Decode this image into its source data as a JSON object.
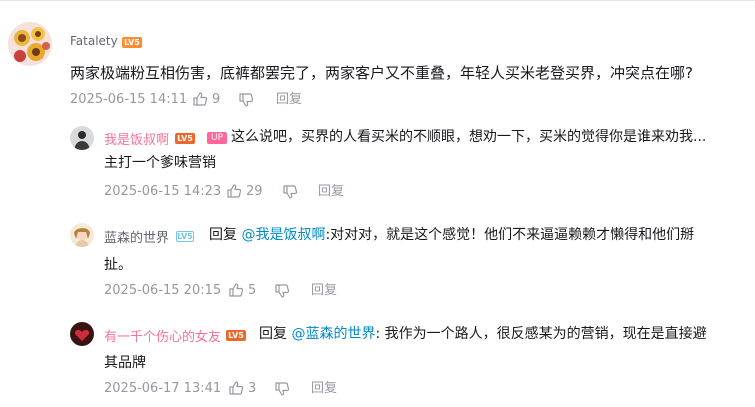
{
  "comments": [
    {
      "username": "Fatalety",
      "level": "LV5",
      "content": "两家极端粉互相伤害，底裤都罢完了，两家客户又不重叠，年轻人买米老登买界，冲突点在哪?",
      "time": "2025-06-15 14:11",
      "likes": "9",
      "reply_label": "回复"
    }
  ],
  "replies": [
    {
      "username": "我是饭叔啊",
      "level": "LV5",
      "badge": "UP",
      "line1": "这么说吧，买界的人看买米的不顺眼，想劝一下，买米的觉得你是谁来劝我...",
      "line2": "主打一个爹味营销",
      "time": "2025-06-15 14:23",
      "likes": "29",
      "reply_label": "回复"
    },
    {
      "username": "蓝森的世界",
      "level": "LV5",
      "reply_prefix": "回复",
      "mention": "@我是饭叔啊",
      "line1": ":对对对，就是这个感觉！他们不来逼逼赖赖才懒得和他们掰",
      "line2": "扯。",
      "time": "2025-06-15 20:15",
      "likes": "5",
      "reply_label": "回复"
    },
    {
      "username": "有一千个伤心的女友",
      "level": "LV5",
      "reply_prefix": "回复",
      "mention": "@蓝森的世界",
      "line1": ": 我作为一个路人，很反感某为的营销，现在是直接避",
      "line2": "其品牌",
      "time": "2025-06-17 13:41",
      "likes": "3",
      "reply_label": "回复"
    }
  ],
  "icons": {
    "like": "thumbs-up-icon",
    "dislike": "thumbs-down-icon"
  },
  "colors": {
    "vip_pink": "#fb7299",
    "normal_name": "#61666d",
    "level_orange": "#ff8b33",
    "level_blue": "#73c9e5",
    "level_red": "#ee672a",
    "mention_blue": "#008ac5",
    "meta_gray": "#9499a0"
  }
}
